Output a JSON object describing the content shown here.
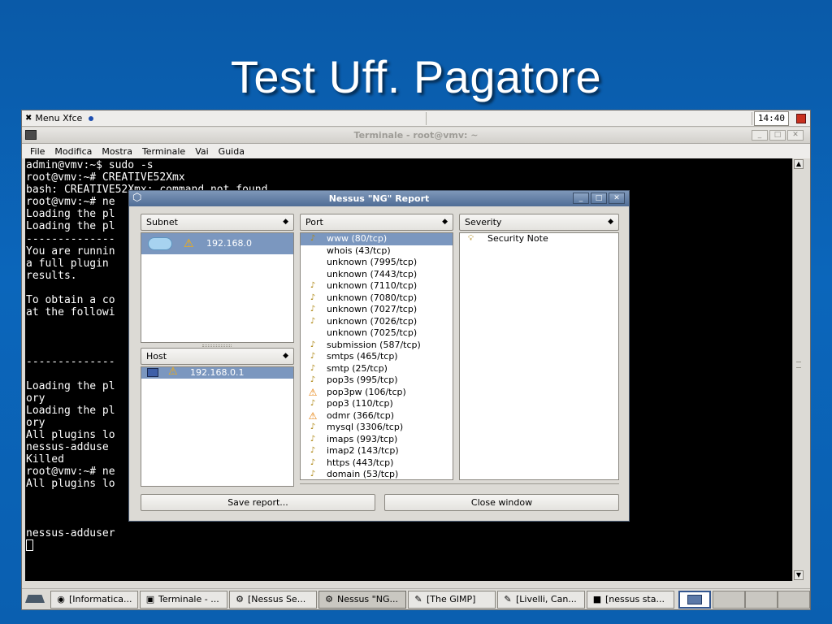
{
  "slide": {
    "title": "Test Uff. Pagatore"
  },
  "top_panel": {
    "menu_label": "Menu Xfce",
    "clock": "14:40"
  },
  "terminal": {
    "title": "Terminale - root@vmv: ~",
    "window_controls": [
      "_",
      "□",
      "✕"
    ],
    "menu": [
      "File",
      "Modifica",
      "Mostra",
      "Terminale",
      "Vai",
      "Guida"
    ],
    "lines": [
      "admin@vmv:~$ sudo -s",
      "root@vmv:~# CREATIVE52Xmx",
      "bash: CREATIVE52Xmx: command not found",
      "root@vmv:~# ne",
      "Loading the pl                                                                        ry",
      "Loading the pl",
      "--------------",
      "You are runnin",
      "a full plugin",
      "results.",
      "",
      "To obtain a co",
      "at the followi",
      "",
      "",
      "",
      "--------------",
      "",
      "Loading the pl                                                                        ct",
      "ory",
      "Loading the pl                                                                        ct",
      "ory",
      "All plugins lo",
      "nessus-adduse",
      "Killed",
      "root@vmv:~# ne",
      "All plugins lo",
      "",
      "",
      "",
      "nessus-adduser"
    ]
  },
  "dialog": {
    "title": "Nessus \"NG\" Report",
    "window_controls": [
      "_",
      "□",
      "✕"
    ],
    "subnet_header": "Subnet",
    "subnet_item": "192.168.0",
    "host_header": "Host",
    "host_item": "192.168.0.1",
    "port_header": "Port",
    "ports": [
      "www (80/tcp)",
      "whois (43/tcp)",
      "unknown (7995/tcp)",
      "unknown (7443/tcp)",
      "unknown (7110/tcp)",
      "unknown (7080/tcp)",
      "unknown (7027/tcp)",
      "unknown (7026/tcp)",
      "unknown (7025/tcp)",
      "submission (587/tcp)",
      "smtps (465/tcp)",
      "smtp (25/tcp)",
      "pop3s (995/tcp)",
      "pop3pw (106/tcp)",
      "pop3 (110/tcp)",
      "odmr (366/tcp)",
      "mysql (3306/tcp)",
      "imaps (993/tcp)",
      "imap2 (143/tcp)",
      "https (443/tcp)",
      "domain (53/tcp)"
    ],
    "port_icons": [
      "bulb-icon",
      "none",
      "none",
      "none",
      "bulb-icon",
      "bulb-icon",
      "bulb-icon",
      "bulb-icon",
      "none",
      "bulb-icon",
      "bulb-icon",
      "bulb-icon",
      "bulb-icon",
      "warning-icon",
      "bulb-icon",
      "warning-icon",
      "bulb-icon",
      "bulb-icon",
      "bulb-icon",
      "bulb-icon",
      "bulb-icon"
    ],
    "severity_header": "Severity",
    "severity_item": "Security Note",
    "save_button": "Save report...",
    "close_button": "Close window"
  },
  "taskbar": {
    "items": [
      {
        "label": "[Informatica...",
        "icon": "globe-icon"
      },
      {
        "label": "Terminale - ...",
        "icon": "terminal-icon"
      },
      {
        "label": "[Nessus Se...",
        "icon": "gear-icon"
      },
      {
        "label": "Nessus \"NG...",
        "icon": "gear-icon"
      },
      {
        "label": "[The GIMP]",
        "icon": "gimp-icon"
      },
      {
        "label": "[Livelli, Can...",
        "icon": "gimp-icon"
      },
      {
        "label": "[nessus sta...",
        "icon": "window-icon"
      }
    ]
  }
}
